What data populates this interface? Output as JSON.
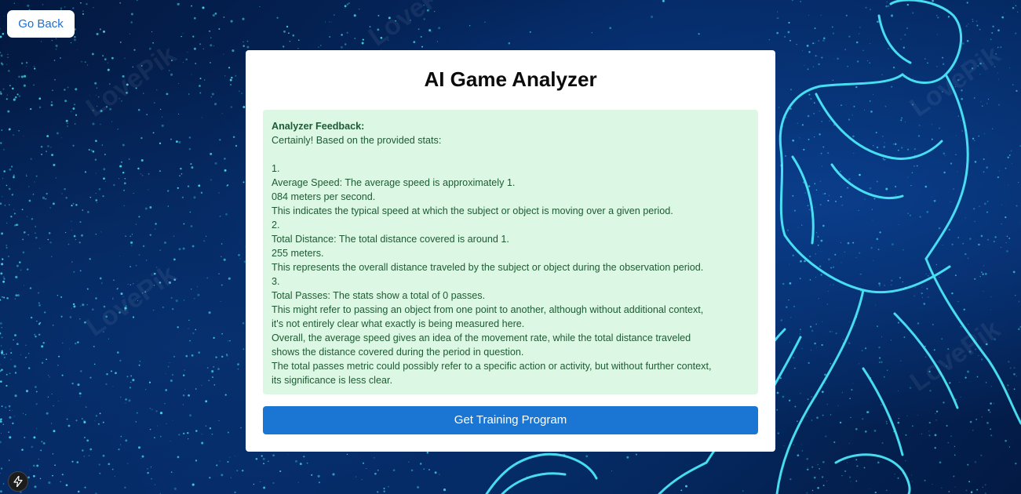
{
  "nav": {
    "go_back_label": "Go Back"
  },
  "card": {
    "title": "AI Game Analyzer",
    "feedback": {
      "heading": "Analyzer Feedback:",
      "lines": [
        "Certainly! Based on the provided stats:",
        "",
        "1.",
        "Average Speed: The average speed is approximately 1.",
        "084 meters per second.",
        "This indicates the typical speed at which the subject or object is moving over a given period.",
        "2.",
        "Total Distance: The total distance covered is around 1.",
        "255 meters.",
        "This represents the overall distance traveled by the subject or object during the observation period.",
        "3.",
        "Total Passes: The stats show a total of 0 passes.",
        "This might refer to passing an object from one point to another, although without additional context,",
        "it's not entirely clear what exactly is being measured here.",
        "Overall, the average speed gives an idea of the movement rate, while the total distance traveled",
        "shows the distance covered during the period in question.",
        "The total passes metric could possibly refer to a specific action or activity, but without further context,",
        "its significance is less clear."
      ]
    },
    "training_button_label": "Get Training Program"
  },
  "badge": {
    "icon": "lightning-icon"
  },
  "colors": {
    "button_primary": "#1b76d3",
    "feedback_bg": "#dcf8e4",
    "feedback_text": "#1e5a33",
    "background_dark": "#03183f",
    "art_cyan": "#4ff0ff"
  }
}
